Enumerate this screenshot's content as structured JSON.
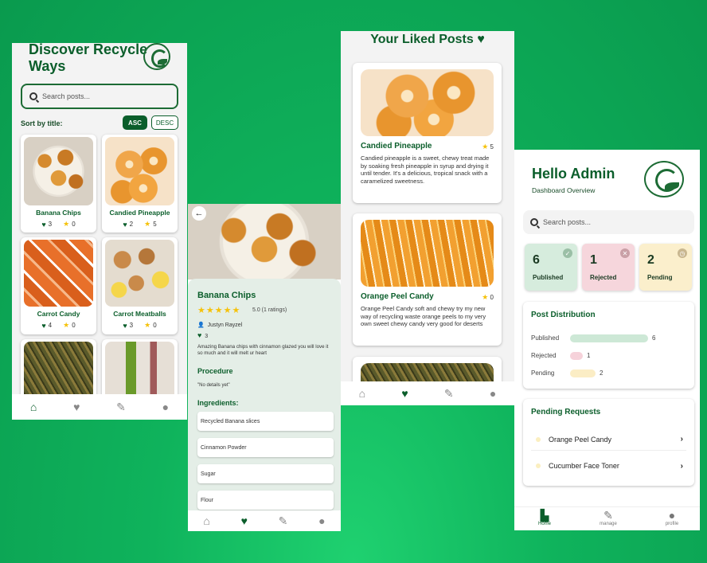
{
  "screen1": {
    "title": "Discover Recycle Ways",
    "search_placeholder": "Search posts...",
    "sort_label": "Sort by title:",
    "asc": "ASC",
    "desc": "DESC",
    "cards": [
      {
        "name": "Banana Chips",
        "likes": "3",
        "rating": "0"
      },
      {
        "name": "Candied Pineapple",
        "likes": "2",
        "rating": "5"
      },
      {
        "name": "Carrot Candy",
        "likes": "4",
        "rating": "0"
      },
      {
        "name": "Carrot Meatballs",
        "likes": "3",
        "rating": "0"
      }
    ]
  },
  "screen2": {
    "back": "←",
    "title": "Banana Chips",
    "stars": "★★★★★",
    "rating_text": "5.0 (1 ratings)",
    "author": "Justyn Rayzel",
    "likes": "3",
    "description": "Amazing Banana chips with cinnamon glazed you will love it so much and it will melt ur heart",
    "procedure_heading": "Procedure",
    "procedure_text": "\"No details yet\"",
    "ingredients_heading": "Ingredients:",
    "ingredients": [
      "Recycled Banana slices",
      "Cinnamon Powder",
      "Sugar",
      "Flour"
    ]
  },
  "screen3": {
    "title": "Your Liked Posts ♥",
    "posts": [
      {
        "name": "Candied Pineapple",
        "rating": "5",
        "description": "Candied pineapple is a sweet, chewy treat made by soaking fresh pineapple in syrup and drying it until tender. It's a delicious, tropical snack with a caramelized sweetness."
      },
      {
        "name": "Orange Peel Candy",
        "rating": "0",
        "description": "Orange Peel Candy soft and chewy try my new way of recycling waste orange peels to my very own sweet chewy candy very good for deserts"
      }
    ]
  },
  "screen4": {
    "hello": "Hello Admin",
    "subtitle": "Dashboard Overview",
    "search_placeholder": "Search posts...",
    "stats": [
      {
        "num": "6",
        "label": "Published",
        "icon": "✓",
        "bg": "#d6ecdd",
        "icon_bg": "#9bbfa6"
      },
      {
        "num": "1",
        "label": "Rejected",
        "icon": "✕",
        "bg": "#f6d6dc",
        "icon_bg": "#c9a0a6"
      },
      {
        "num": "2",
        "label": "Pending",
        "icon": "◷",
        "bg": "#fbefcc",
        "icon_bg": "#c9b790"
      }
    ],
    "distribution_title": "Post Distribution",
    "distribution": [
      {
        "label": "Published",
        "value": "6",
        "color": "#cde8d6"
      },
      {
        "label": "Rejected",
        "value": "1",
        "color": "#f6d2da"
      },
      {
        "label": "Pending",
        "value": "2",
        "color": "#fbedc5"
      }
    ],
    "pending_title": "Pending Requests",
    "pending": [
      "Orange Peel Candy",
      "Cucumber Face Toner"
    ],
    "nav": [
      "Home",
      "manage",
      "profile"
    ]
  }
}
